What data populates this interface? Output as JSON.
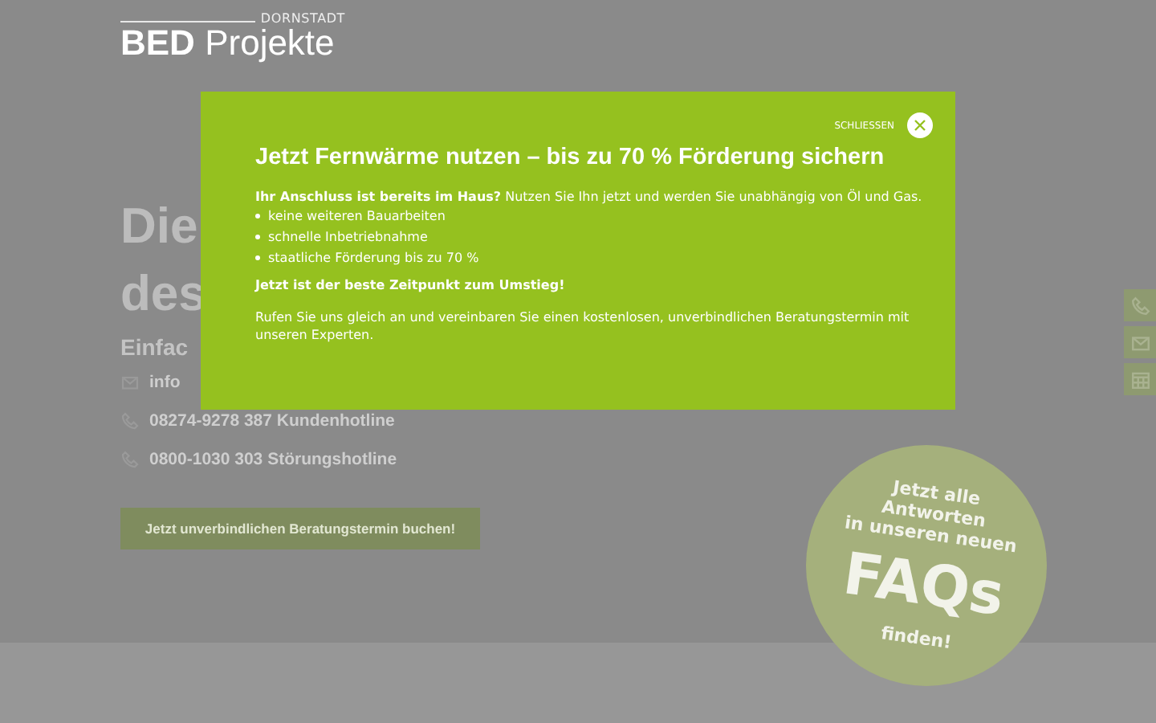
{
  "logo": {
    "location": "DORNSTADT",
    "brand_bold": "BED",
    "brand": "Projekte"
  },
  "hero": {
    "title_lines": [
      "Die",
      "des"
    ],
    "subtitle": "Einfac",
    "contacts": [
      {
        "kind": "mail",
        "text": "info"
      },
      {
        "kind": "phone",
        "text": "08274-9278 387 Kundenhotline"
      },
      {
        "kind": "phone",
        "text": "0800-1030 303 Störungshotline"
      }
    ],
    "cta": "Jetzt unverbindlichen Beratungstermin buchen!"
  },
  "side_buttons": [
    {
      "kind": "phone"
    },
    {
      "kind": "mail"
    },
    {
      "kind": "calendar"
    }
  ],
  "faq_badge": {
    "lines": [
      "Jetzt alle",
      "Antworten",
      "in unseren neuen"
    ],
    "big": "FAQs",
    "after": "finden!"
  },
  "modal": {
    "close_label": "SCHLIESSEN",
    "title": "Jetzt Fernwärme nutzen – bis zu 70 % Förderung sichern",
    "intro": "**Ihr Anschluss ist bereits im Haus?** Nutzen Sie Ihn jetzt und werden Sie unabhängig von Öl und Gas.",
    "bullets": [
      "keine weiteren Bauarbeiten",
      "schnelle Inbetriebnahme",
      "staatliche Förderung bis zu 70 %"
    ],
    "highlight": "Jetzt ist der beste Zeitpunkt zum Umstieg!",
    "text": "Rufen Sie uns gleich an und vereinbaren Sie einen kostenlosen, unverbindlichen Beratungstermin mit unseren Experten."
  }
}
